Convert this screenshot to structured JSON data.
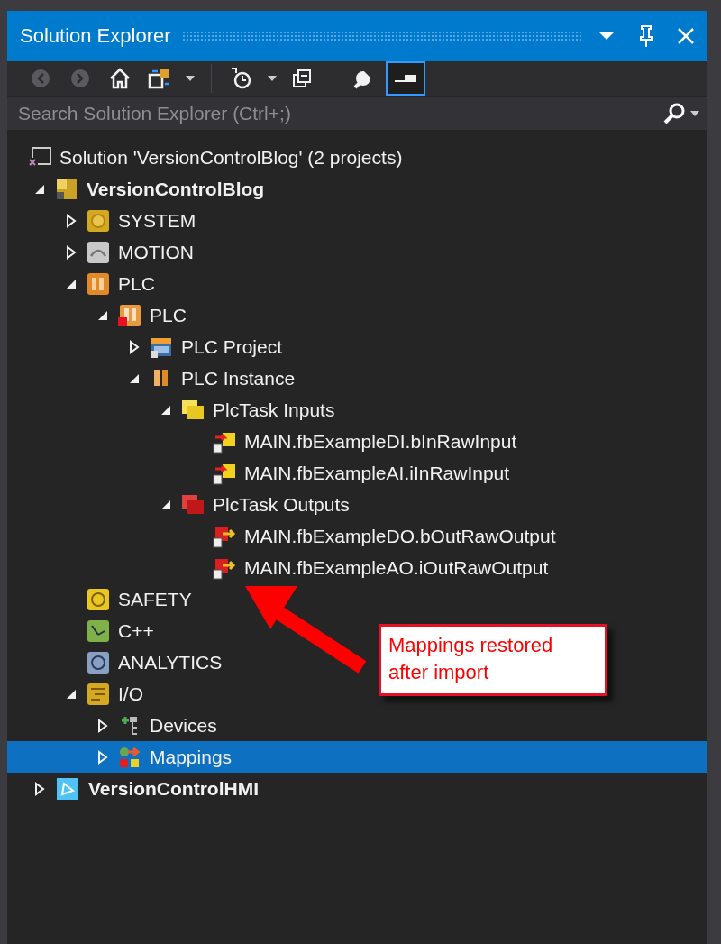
{
  "window": {
    "title": "Solution Explorer"
  },
  "toolbar": [
    {
      "kind": "back",
      "disabled": true,
      "active": false
    },
    {
      "kind": "forward",
      "disabled": true,
      "active": false
    },
    {
      "kind": "home",
      "disabled": false,
      "active": false
    },
    {
      "kind": "sync",
      "disabled": false,
      "active": false
    },
    {
      "kind": "dropdown",
      "disabled": false
    },
    {
      "kind": "separator"
    },
    {
      "kind": "history",
      "disabled": false,
      "active": false
    },
    {
      "kind": "dropdown",
      "disabled": false
    },
    {
      "kind": "collapse",
      "disabled": false,
      "active": false
    },
    {
      "kind": "separator"
    },
    {
      "kind": "properties",
      "disabled": false,
      "active": false
    },
    {
      "kind": "preview",
      "disabled": false,
      "active": true
    }
  ],
  "search": {
    "placeholder": "Search Solution Explorer (Ctrl+;)"
  },
  "solution": {
    "label": "Solution 'VersionControlBlog' (2 projects)",
    "selected": false
  },
  "tree": [
    {
      "label": "VersionControlBlog",
      "kind": "project",
      "expanded": true,
      "selected": false,
      "children": [
        {
          "label": "SYSTEM",
          "kind": "system",
          "expanded": false,
          "selected": false
        },
        {
          "label": "MOTION",
          "kind": "motion",
          "expanded": false,
          "selected": false
        },
        {
          "label": "PLC",
          "kind": "plc",
          "expanded": true,
          "selected": false,
          "children": [
            {
              "label": "PLC",
              "kind": "plc-module",
              "expanded": true,
              "selected": false,
              "children": [
                {
                  "label": "PLC Project",
                  "kind": "plc-project",
                  "expanded": false,
                  "selected": false
                },
                {
                  "label": "PLC Instance",
                  "kind": "plc-instance",
                  "expanded": true,
                  "selected": false,
                  "children": [
                    {
                      "label": "PlcTask Inputs",
                      "kind": "inputs",
                      "expanded": true,
                      "selected": false,
                      "children": [
                        {
                          "label": "MAIN.fbExampleDI.bInRawInput",
                          "kind": "input-var",
                          "selected": false
                        },
                        {
                          "label": "MAIN.fbExampleAI.iInRawInput",
                          "kind": "input-var",
                          "selected": false
                        }
                      ]
                    },
                    {
                      "label": "PlcTask Outputs",
                      "kind": "outputs",
                      "expanded": true,
                      "selected": false,
                      "children": [
                        {
                          "label": "MAIN.fbExampleDO.bOutRawOutput",
                          "kind": "output-var",
                          "selected": false
                        },
                        {
                          "label": "MAIN.fbExampleAO.iOutRawOutput",
                          "kind": "output-var",
                          "selected": false
                        }
                      ]
                    }
                  ]
                }
              ]
            }
          ]
        },
        {
          "label": "SAFETY",
          "kind": "safety",
          "selected": false
        },
        {
          "label": "C++",
          "kind": "cpp",
          "selected": false
        },
        {
          "label": "ANALYTICS",
          "kind": "analytics",
          "selected": false
        },
        {
          "label": "I/O",
          "kind": "io",
          "expanded": true,
          "selected": false,
          "children": [
            {
              "label": "Devices",
              "kind": "devices",
              "expanded": false,
              "selected": false
            },
            {
              "label": "Mappings",
              "kind": "mappings",
              "expanded": false,
              "selected": true
            }
          ]
        }
      ]
    },
    {
      "label": "VersionControlHMI",
      "kind": "hmi-project",
      "expanded": false,
      "selected": false
    }
  ],
  "callout": {
    "text": "Mappings restored after import"
  }
}
